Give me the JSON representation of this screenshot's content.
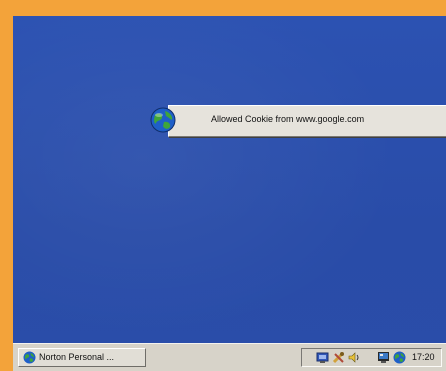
{
  "notification": {
    "message": "Allowed Cookie from www.google.com",
    "close_glyph": "×",
    "icon": "globe-icon"
  },
  "taskbar": {
    "task_button": {
      "label": "Norton Personal ...",
      "icon": "globe-icon"
    },
    "tray": {
      "icons": [
        "network-icon",
        "tools-icon",
        "sound-icon",
        "monitor-icon",
        "globe-icon"
      ],
      "clock": "17:20"
    }
  },
  "colors": {
    "frame": "#f3a33a",
    "desktop": "#2a4fae",
    "taskbar": "#d7d3c9"
  }
}
